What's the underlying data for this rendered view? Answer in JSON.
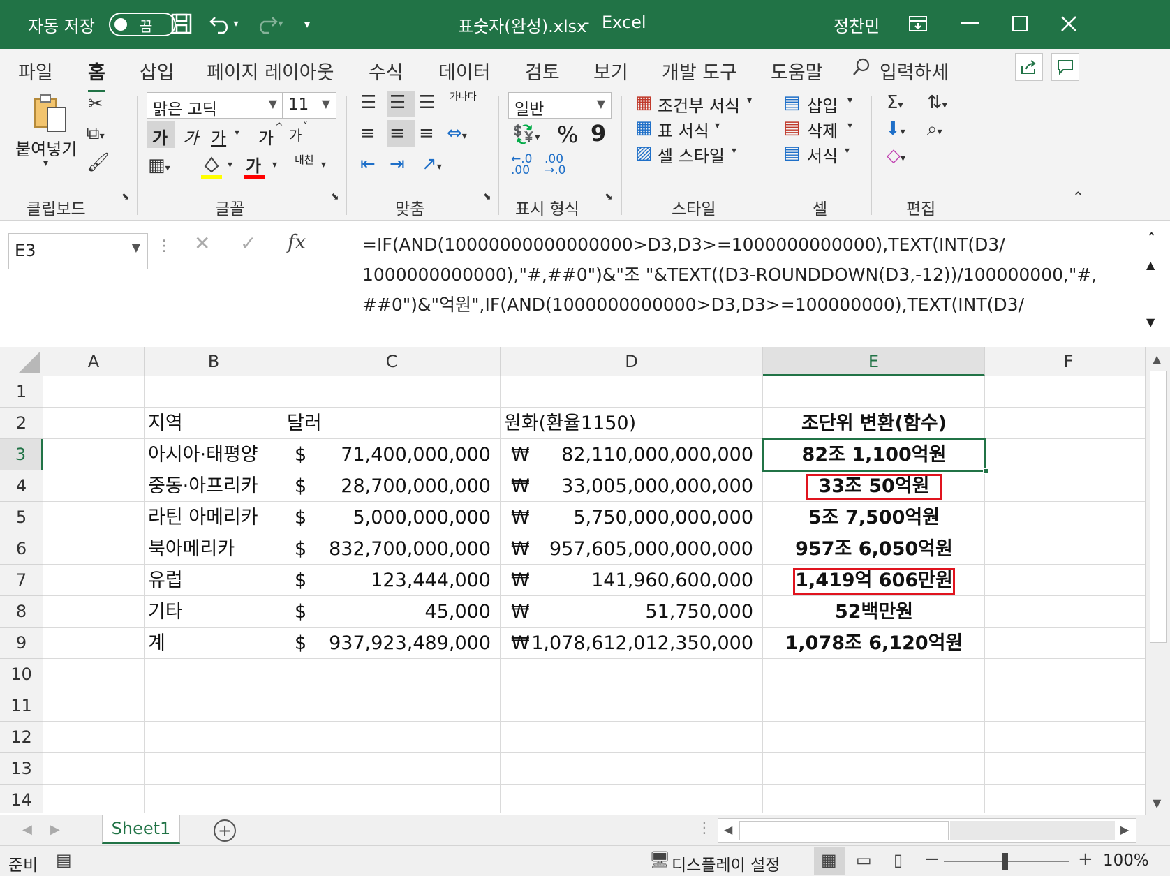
{
  "titlebar": {
    "autosave_label": "자동 저장",
    "autosave_state": "끔",
    "filename": "표숫자(완성).xlsx",
    "separator": "-",
    "app_name": "Excel",
    "user": "정찬민"
  },
  "tabs": [
    "파일",
    "홈",
    "삽입",
    "페이지 레이아웃",
    "수식",
    "데이터",
    "검토",
    "보기",
    "개발 도구",
    "도움말"
  ],
  "search_placeholder": "입력하세",
  "ribbon": {
    "clipboard": {
      "paste": "붙여넣기",
      "label": "클립보드"
    },
    "font": {
      "name": "맑은 고딕",
      "size": "11",
      "bold": "가",
      "italic": "가",
      "underline": "가",
      "grow": "가",
      "shrink": "가",
      "color_a": "가",
      "phonetic": "내천",
      "label": "글꼴"
    },
    "align": {
      "wrap": "가나다",
      "label": "맞춤"
    },
    "number": {
      "format": "일반",
      "percent": "%",
      "comma": "9",
      "label": "표시 형식"
    },
    "styles": {
      "cond": "조건부 서식",
      "table": "표 서식",
      "cell": "셀 스타일",
      "label": "스타일"
    },
    "cells": {
      "insert": "삽입",
      "delete": "삭제",
      "format": "서식",
      "label": "셀"
    },
    "edit": {
      "label": "편집"
    }
  },
  "formula_bar": {
    "name_box": "E3",
    "fx": "fx",
    "formula_lines": [
      "=IF(AND(10000000000000000>D3,D3>=1000000000000),TEXT(INT(D3/",
      "1000000000000),\"#,##0\")&\"조 \"&TEXT((D3-ROUNDDOWN(D3,-12))/100000000,\"#,",
      "##0\")&\"억원\",IF(AND(1000000000000>D3,D3>=100000000),TEXT(INT(D3/"
    ]
  },
  "columns": [
    "A",
    "B",
    "C",
    "D",
    "E",
    "F"
  ],
  "rows": [
    "1",
    "2",
    "3",
    "4",
    "5",
    "6",
    "7",
    "8",
    "9",
    "10",
    "11",
    "12",
    "13",
    "14"
  ],
  "headers": {
    "region": "지역",
    "dollar": "달러",
    "won": "원화(환율1150)",
    "converted": "조단위 변환(함수)"
  },
  "table": [
    {
      "region": "아시아·태평양",
      "usd_sym": "$",
      "usd": "71,400,000,000",
      "krw_sym": "₩",
      "krw": "82,110,000,000,000",
      "conv": "82조 1,100억원"
    },
    {
      "region": "중동·아프리카",
      "usd_sym": "$",
      "usd": "28,700,000,000",
      "krw_sym": "₩",
      "krw": "33,005,000,000,000",
      "conv": "33조 50억원"
    },
    {
      "region": "라틴 아메리카",
      "usd_sym": "$",
      "usd": "5,000,000,000",
      "krw_sym": "₩",
      "krw": "5,750,000,000,000",
      "conv": "5조 7,500억원"
    },
    {
      "region": "북아메리카",
      "usd_sym": "$",
      "usd": "832,700,000,000",
      "krw_sym": "₩",
      "krw": "957,605,000,000,000",
      "conv": "957조 6,050억원"
    },
    {
      "region": "유럽",
      "usd_sym": "$",
      "usd": "123,444,000",
      "krw_sym": "₩",
      "krw": "141,960,600,000",
      "conv": "1,419억 606만원"
    },
    {
      "region": "기타",
      "usd_sym": "$",
      "usd": "45,000",
      "krw_sym": "₩",
      "krw": "51,750,000",
      "conv": "52백만원"
    },
    {
      "region": "계",
      "usd_sym": "$",
      "usd": "937,923,489,000",
      "krw_sym": "₩",
      "krw": "1,078,612,012,350,000",
      "conv": "1,078조 6,120억원"
    }
  ],
  "sheet_tab": "Sheet1",
  "status": {
    "ready": "준비",
    "display_settings": "디스플레이 설정",
    "zoom": "100%"
  },
  "colors": {
    "accent": "#217346",
    "highlight_box": "#e0141e"
  }
}
